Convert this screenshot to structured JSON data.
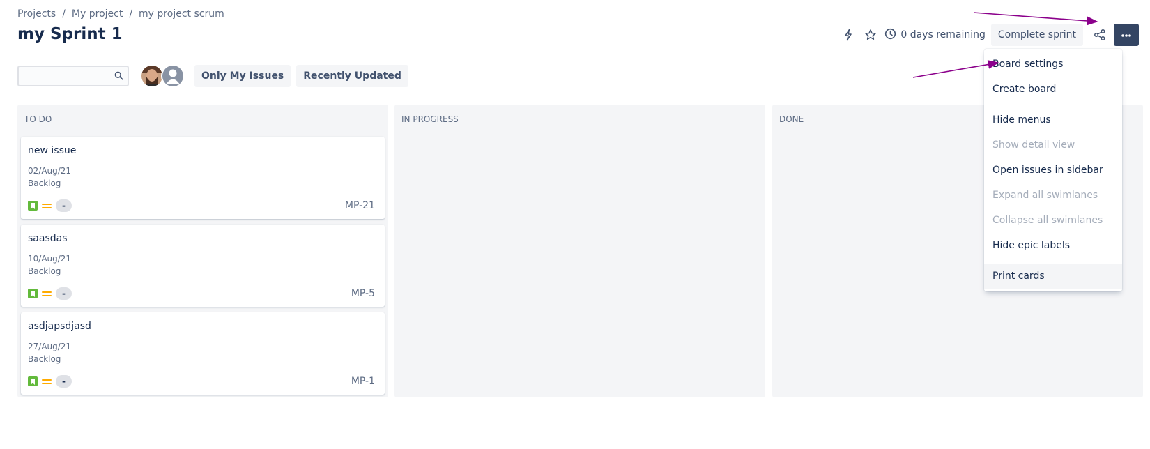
{
  "breadcrumb": {
    "items": [
      "Projects",
      "My project",
      "my project scrum"
    ],
    "separator": "/"
  },
  "page_title": "my Sprint 1",
  "toolbar": {
    "automation_icon": "lightning-bolt-icon",
    "star_icon": "star-icon",
    "clock_icon": "clock-icon",
    "remaining": "0 days remaining",
    "complete_sprint": "Complete sprint",
    "share_icon": "share-icon",
    "more_icon": "more-icon"
  },
  "filters": {
    "search_placeholder": "",
    "only_my_issues": "Only My Issues",
    "recently_updated": "Recently Updated"
  },
  "columns": [
    {
      "title": "TO DO"
    },
    {
      "title": "IN PROGRESS"
    },
    {
      "title": "DONE"
    }
  ],
  "cards": [
    {
      "title": "new issue",
      "date": "02/Aug/21",
      "status": "Backlog",
      "estimate": "-",
      "key": "MP-21"
    },
    {
      "title": "saasdas",
      "date": "10/Aug/21",
      "status": "Backlog",
      "estimate": "-",
      "key": "MP-5"
    },
    {
      "title": "asdjapsdjasd",
      "date": "27/Aug/21",
      "status": "Backlog",
      "estimate": "-",
      "key": "MP-1"
    }
  ],
  "menu": {
    "items": [
      {
        "label": "Board settings",
        "enabled": true
      },
      {
        "label": "Create board",
        "enabled": true
      },
      {
        "label": "Hide menus",
        "enabled": true
      },
      {
        "label": "Show detail view",
        "enabled": false
      },
      {
        "label": "Open issues in sidebar",
        "enabled": true
      },
      {
        "label": "Expand all swimlanes",
        "enabled": false
      },
      {
        "label": "Collapse all swimlanes",
        "enabled": false
      },
      {
        "label": "Hide epic labels",
        "enabled": true
      },
      {
        "label": "Print cards",
        "enabled": true
      }
    ]
  },
  "colors": {
    "primary_text": "#172B4D",
    "column_bg": "#F4F5F7",
    "more_button_bg": "#344563",
    "story_icon": "#63BA3C",
    "priority_medium": "#FFAB00",
    "annotation_arrow": "#8B008B"
  }
}
